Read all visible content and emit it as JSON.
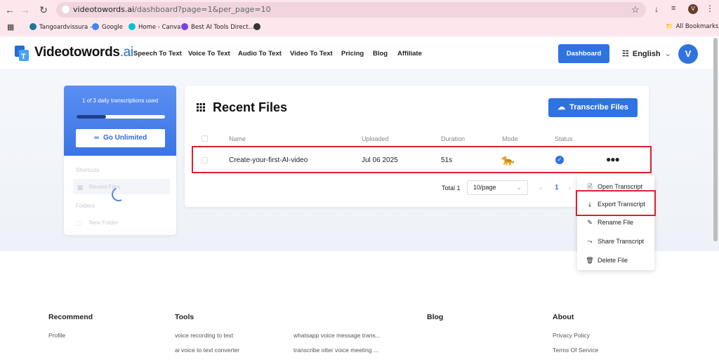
{
  "browser": {
    "url_host": "videotowords.ai",
    "url_path": "/dashboard?page=1&per_page=10",
    "profile_initial": "V",
    "bookmarks": [
      "Tangoardvissura -",
      "Google",
      "Home - Canva",
      "Best AI Tools Direct..."
    ],
    "all_bookmarks": "All Bookmarks"
  },
  "header": {
    "logo_main": "Videotowords",
    "logo_suffix": ".ai",
    "nav": [
      "Speech To Text",
      "Voice To Text",
      "Audio To Text",
      "Video To Text",
      "Pricing",
      "Blog",
      "Affiliate"
    ],
    "dashboard_label": "Dashboard",
    "language": "English",
    "avatar_initial": "V"
  },
  "sidebar": {
    "usage_text": "1 of 3 daily transcriptions used",
    "usage_progress": 0.33,
    "go_unlimited": "Go Unlimited",
    "shortcuts_label": "Shortcuts",
    "recent_files": "Recent Files",
    "folders_label": "Folders",
    "new_folder": "New Folder"
  },
  "main": {
    "title": "Recent Files",
    "transcribe_label": "Transcribe Files",
    "columns": [
      "Name",
      "Uploaded",
      "Duration",
      "Mode",
      "Status"
    ],
    "rows": [
      {
        "name": "Create-your-first-AI-video",
        "uploaded": "Jul 06 2025",
        "duration": "51s",
        "mode": "🐆"
      }
    ],
    "total": "Total 1",
    "per_page": "10/page",
    "page": "1"
  },
  "menu": {
    "items": [
      "Open Transcript",
      "Export Transcript",
      "Rename File",
      "Share Transcript",
      "Delete File"
    ]
  },
  "footer": {
    "recommend": "Recommend",
    "profile": "Profile",
    "tools": "Tools",
    "tools_links": [
      "voice recording to text",
      "ai voice to text converter",
      "whatsapp voice message trans...",
      "transcribe otter voice meeting ..."
    ],
    "blog": "Blog",
    "about": "About",
    "about_links": [
      "Privacy Policy",
      "Terms Of Service"
    ]
  },
  "colors": {
    "accent": "#2f73e0",
    "highlight": "#d8232a",
    "chrome": "#fde7ed"
  }
}
